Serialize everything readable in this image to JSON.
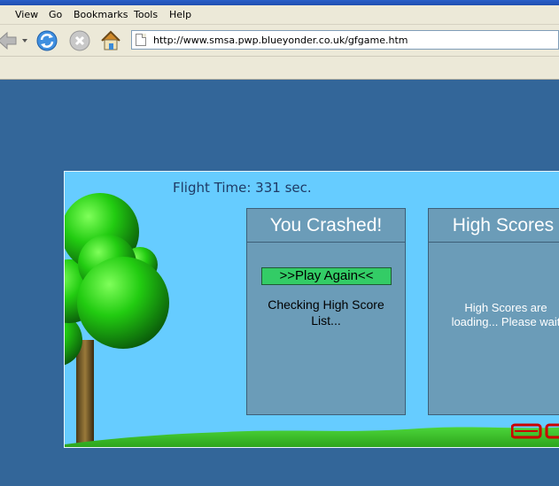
{
  "browser": {
    "menu": {
      "view": "View",
      "go": "Go",
      "bookmarks": "Bookmarks",
      "tools": "Tools",
      "help": "Help"
    },
    "url": "http://www.smsa.pwp.blueyonder.co.uk/gfgame.htm",
    "icons": {
      "back": "back-arrow-icon",
      "dropdown": "chevron-down-icon",
      "reload": "reload-icon",
      "stop": "stop-icon",
      "home": "home-icon",
      "page": "document-icon"
    }
  },
  "game": {
    "flight_time": "Flight Time: 331 sec.",
    "crash_panel": {
      "title": "You Crashed!",
      "play_again": ">>Play Again<<",
      "status": "Checking High Score List..."
    },
    "scores_panel": {
      "title": "High Scores",
      "status": "High Scores are loading... Please wait"
    },
    "colors": {
      "sky": "#66ccff",
      "panel": "#6b9cb8",
      "button": "#33cc66",
      "page_bg": "#336699",
      "logo": "#cc0000"
    }
  }
}
